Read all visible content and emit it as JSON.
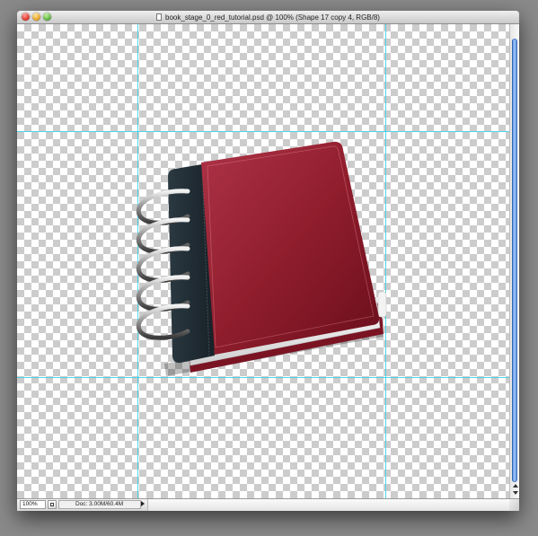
{
  "window": {
    "title": "book_stage_0_red_tutorial.psd @ 100% (Shape 17 copy 4, RGB/8)"
  },
  "statusbar": {
    "zoom": "100%",
    "doc_info": "Doc: 3.00M/60.4M"
  },
  "colors": {
    "guide": "#3fd3e8",
    "cover_red": "#8f1d2c",
    "spine_dark": "#1f2b33",
    "scroll_thumb": "#4a86dc"
  },
  "icons": {
    "close": "close-icon",
    "minimize": "minimize-icon",
    "zoom": "zoom-icon",
    "document": "document-icon",
    "status_menu": "triangle-right-icon"
  }
}
